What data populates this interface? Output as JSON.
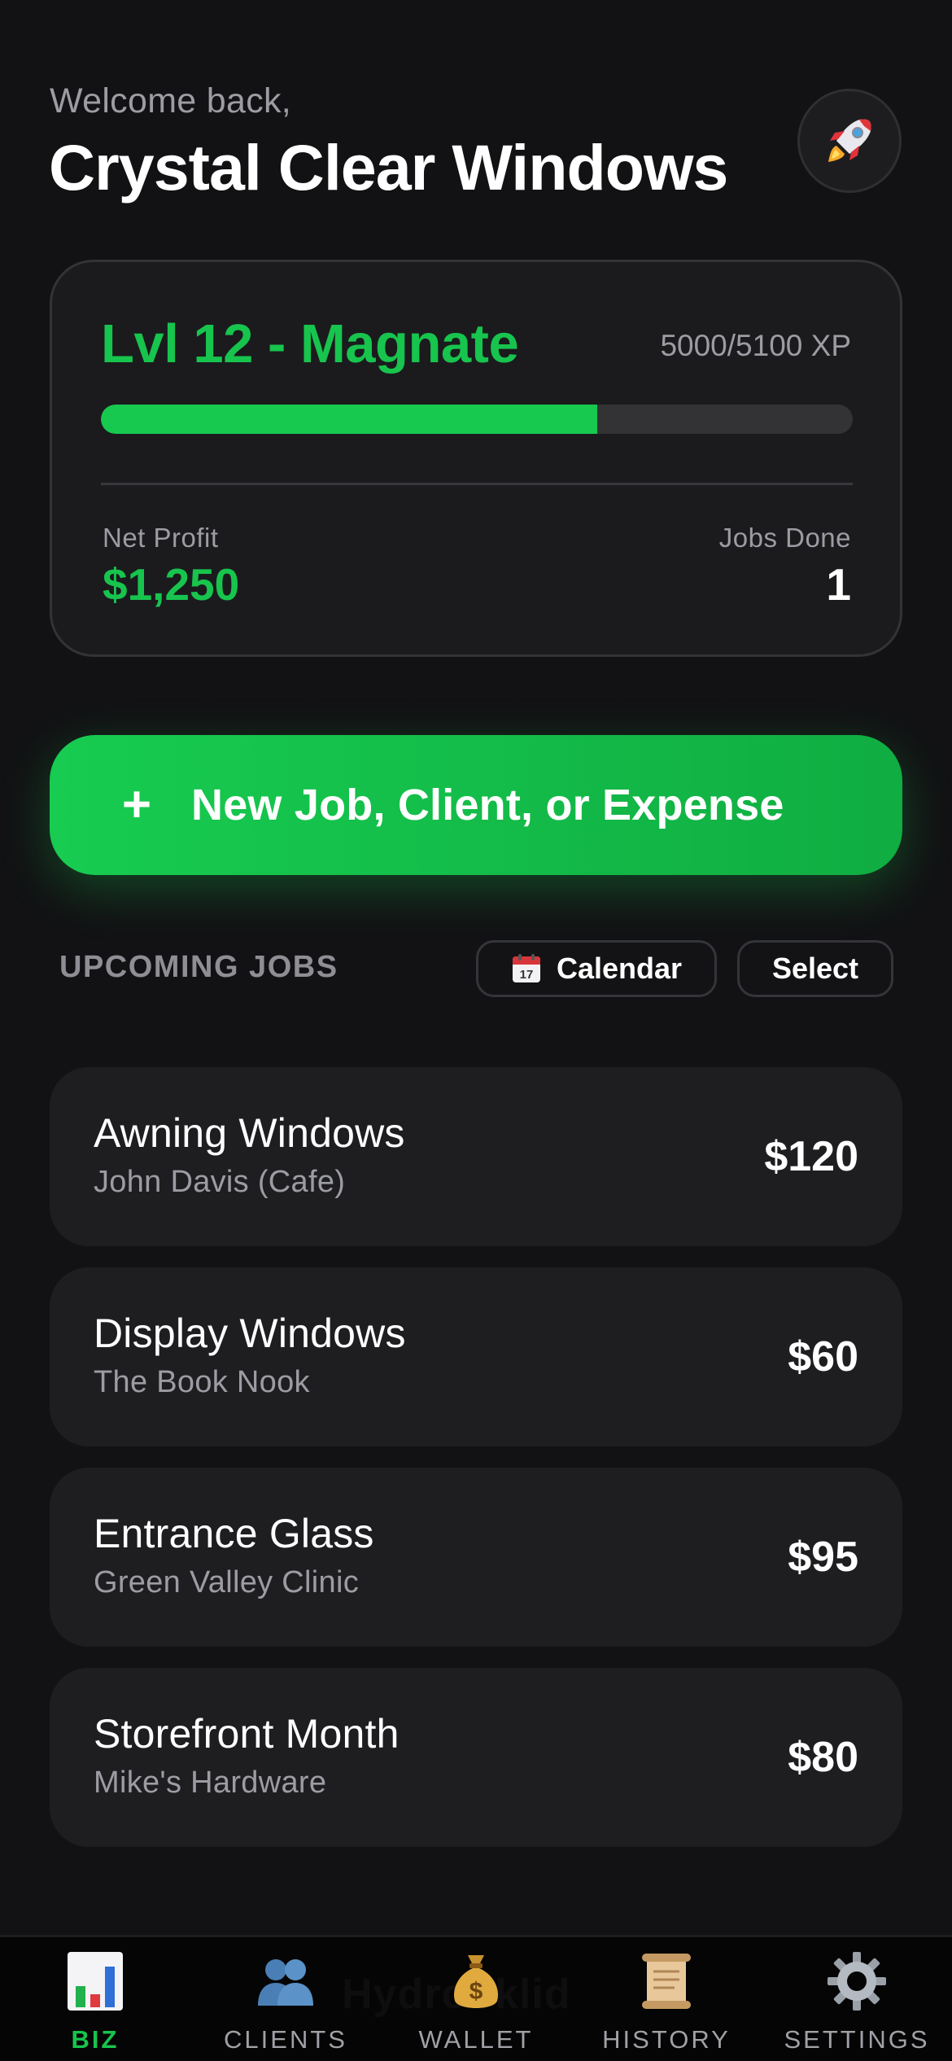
{
  "header": {
    "welcome": "Welcome back,",
    "company": "Crystal Clear Windows",
    "rocket_icon": "rocket-icon"
  },
  "level_card": {
    "level_title": "Lvl 12 - Magnate",
    "xp_text": "5000/5100 XP",
    "xp_progress": 0.66,
    "net_profit_label": "Net Profit",
    "net_profit_value": "$1,250",
    "jobs_done_label": "Jobs Done",
    "jobs_done_value": "1"
  },
  "actions": {
    "new_plus": "+",
    "new_label": "New Job, Client, or Expense"
  },
  "upcoming": {
    "title": "UPCOMING JOBS",
    "calendar_label": "Calendar",
    "select_label": "Select",
    "jobs": [
      {
        "title": "Awning Windows",
        "client": "John Davis (Cafe)",
        "price": "$120"
      },
      {
        "title": "Display Windows",
        "client": "The Book Nook",
        "price": "$60"
      },
      {
        "title": "Entrance Glass",
        "client": "Green Valley Clinic",
        "price": "$95"
      },
      {
        "title": "Storefront Month",
        "client": "Mike's Hardware",
        "price": "$80"
      }
    ]
  },
  "tabbar": {
    "watermark": "Hydrooklid",
    "tabs": [
      {
        "label": "BIZ",
        "icon": "bar-chart-icon",
        "active": true
      },
      {
        "label": "CLIENTS",
        "icon": "users-icon",
        "active": false
      },
      {
        "label": "WALLET",
        "icon": "money-bag-icon",
        "active": false
      },
      {
        "label": "HISTORY",
        "icon": "scroll-icon",
        "active": false
      },
      {
        "label": "SETTINGS",
        "icon": "gear-icon",
        "active": false
      }
    ]
  },
  "colors": {
    "accent_green": "#17c44d",
    "background": "#121214",
    "card": "#1e1e21",
    "muted_text": "#9c9ca3"
  }
}
